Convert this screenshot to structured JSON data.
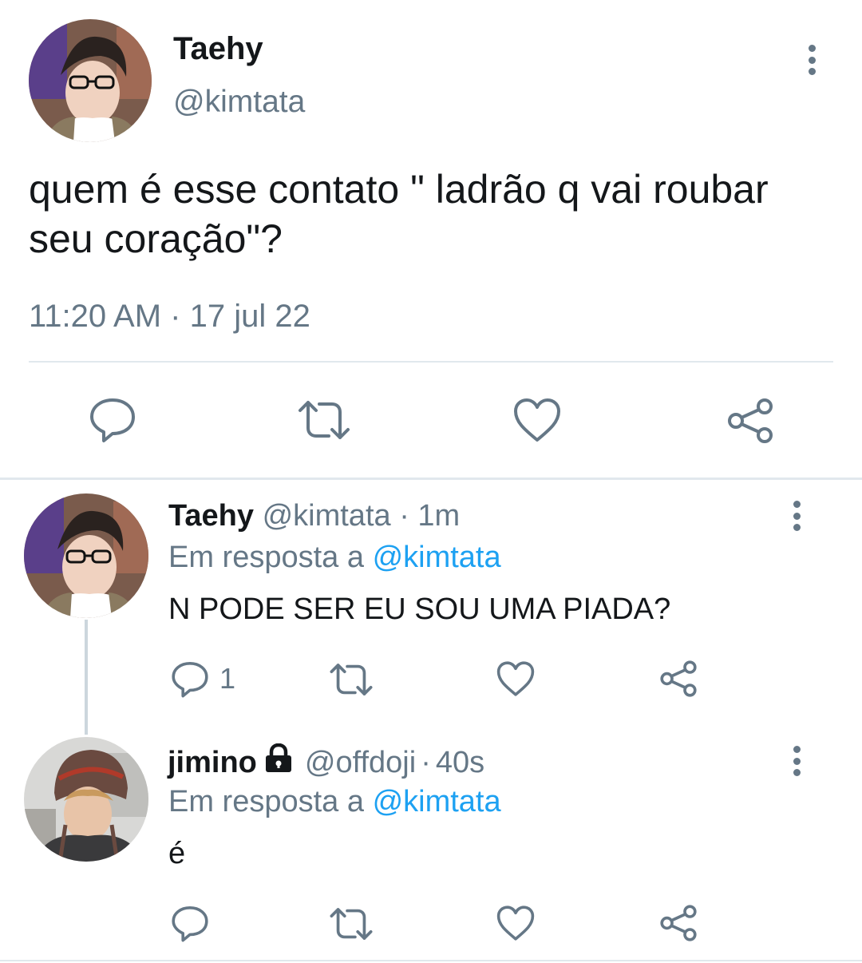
{
  "main_tweet": {
    "display_name": "Taehy",
    "handle": "@kimtata",
    "text": "quem é esse contato \" ladrão q vai roubar seu coração\"?",
    "timestamp": "11:20 AM · 17 jul 22",
    "actions": [
      "reply-icon",
      "retweet-icon",
      "like-icon",
      "share-icon"
    ]
  },
  "replies": [
    {
      "display_name": "Taehy",
      "handle": "@kimtata",
      "time": "1m",
      "reply_prefix": "Em resposta a",
      "reply_to": "@kimtata",
      "text": "N PODE SER EU SOU UMA PIADA?",
      "reply_count": "1",
      "protected": false
    },
    {
      "display_name": "jimino",
      "handle": "@offdoji",
      "time": "40s",
      "reply_prefix": "Em resposta a",
      "reply_to": "@kimtata",
      "text": "é",
      "reply_count": "",
      "protected": true
    }
  ],
  "colors": {
    "accent": "#1da1f2",
    "secondary_text": "#657786",
    "icon": "#657786",
    "divider": "#e1e8ed"
  }
}
